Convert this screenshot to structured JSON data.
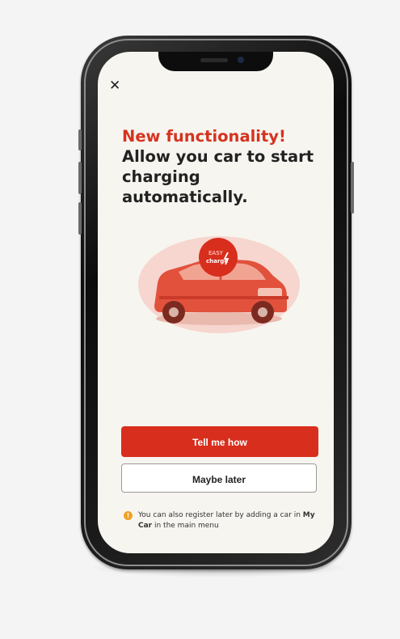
{
  "modal": {
    "close_icon": "close-icon",
    "headline_accent": "New functionality!",
    "headline_rest": "Allow you car to start charging automatically.",
    "badge_line1": "EASY",
    "badge_line2": "charge",
    "primary_button": "Tell me how",
    "secondary_button": "Maybe later",
    "note_prefix": "You can also register later by adding a car in ",
    "note_bold": "My Car",
    "note_suffix": " in the main menu",
    "note_icon": "info-icon"
  },
  "colors": {
    "accent": "#d6331f",
    "button": "#d82e1d",
    "screen_background": "#f7f5f0",
    "info_icon": "#f0a020"
  }
}
